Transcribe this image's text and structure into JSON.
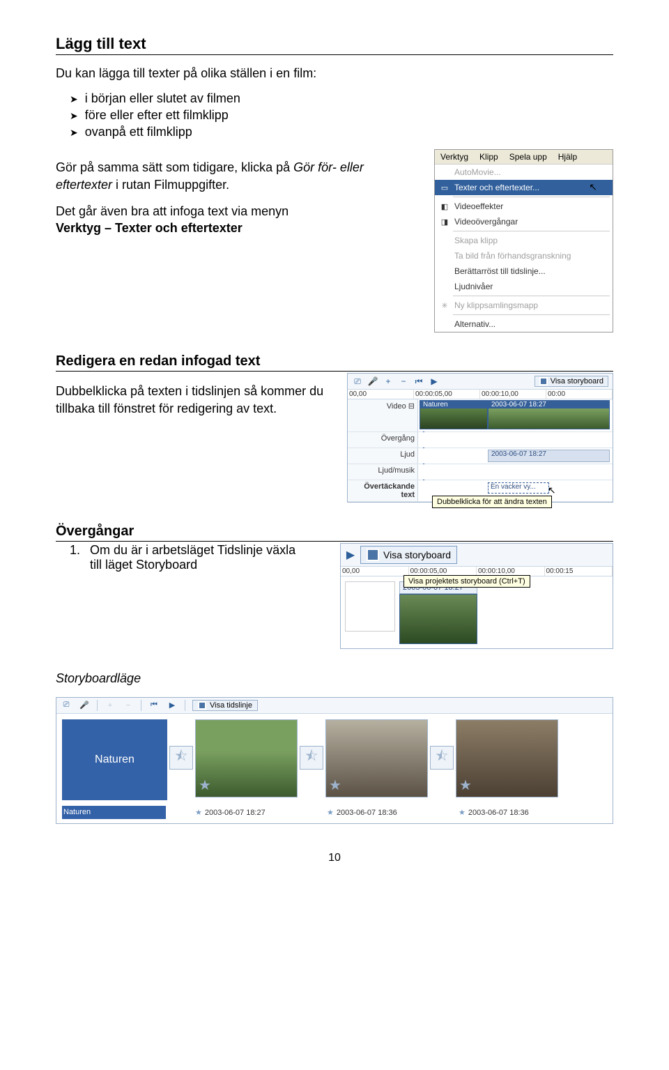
{
  "h1": "Lägg till text",
  "intro": "Du kan lägga till texter på olika ställen i en film:",
  "bullets": [
    "i början eller slutet av filmen",
    "före eller efter ett filmklipp",
    "ovanpå ett filmklipp"
  ],
  "para2_a": "Gör på samma sätt som tidigare, klicka på ",
  "para2_b": "Gör för- eller eftertexter",
  "para2_c": " i rutan Filmuppgifter.",
  "para3_a": "Det går även bra att infoga text via menyn ",
  "para3_b": "Verktyg – Texter och eftertexter",
  "menu": {
    "bar": [
      "Verktyg",
      "Klipp",
      "Spela upp",
      "Hjälp"
    ],
    "items": [
      {
        "label": "AutoMovie...",
        "disabled": true
      },
      {
        "label": "Texter och eftertexter...",
        "selected": true,
        "icon": ""
      },
      {
        "label": "Videoeffekter",
        "icon": "◧"
      },
      {
        "label": "Videoövergångar",
        "icon": "◨"
      },
      {
        "label": "Skapa klipp",
        "disabled": true
      },
      {
        "label": "Ta bild från förhandsgranskning",
        "disabled": true
      },
      {
        "label": "Berättarröst till tidslinje..."
      },
      {
        "label": "Ljudnivåer"
      },
      {
        "label": "Ny klippsamlingsmapp",
        "disabled": true,
        "icon": "✳"
      },
      {
        "label": "Alternativ..."
      }
    ]
  },
  "h2a": "Redigera en redan infogad text",
  "edit_para": "Dubbelklicka på texten i tidslinjen så kommer du tillbaka till fönstret för redigering av text.",
  "timeline": {
    "visa_storyboard": "Visa storyboard",
    "ruler": [
      "00,00",
      "00:00:05,00",
      "00:00:10,00",
      "00:00"
    ],
    "rows": {
      "video": "Video",
      "overgang": "Övergång",
      "ljud": "Ljud",
      "ljudmusik": "Ljud/musik",
      "overtackande": "Övertäckande text"
    },
    "clip_video_label": "Naturen",
    "clip_video_ts": "2003-06-07 18:27",
    "clip_audio_ts": "2003-06-07 18:27",
    "clip_text_label": "En vacker vy...",
    "tooltip": "Dubbelklicka för att ändra texten"
  },
  "h2b": "Övergångar",
  "trans_item_num": "1.",
  "trans_item_text": "Om du är i arbetsläget Tidslinje växla till läget Storyboard",
  "toolbar2": {
    "visa_storyboard": "Visa storyboard",
    "ruler": [
      "00,00",
      "00:00:05,00",
      "00:00:10,00",
      "00:00:15"
    ],
    "tooltip": "Visa projektets storyboard (Ctrl+T)",
    "ts": "2003-06-07 18:27"
  },
  "storyboard_heading": "Storyboardläge",
  "sb": {
    "visa_tidslinje": "Visa tidslinje",
    "items": [
      {
        "title": "Naturen",
        "caption": "Naturen",
        "type": "title",
        "selected": true
      },
      {
        "caption": "2003-06-07 18:27",
        "type": "img1"
      },
      {
        "caption": "2003-06-07 18:36",
        "type": "img2"
      },
      {
        "caption": "2003-06-07 18:36",
        "type": "img3"
      }
    ]
  },
  "page_number": "10"
}
